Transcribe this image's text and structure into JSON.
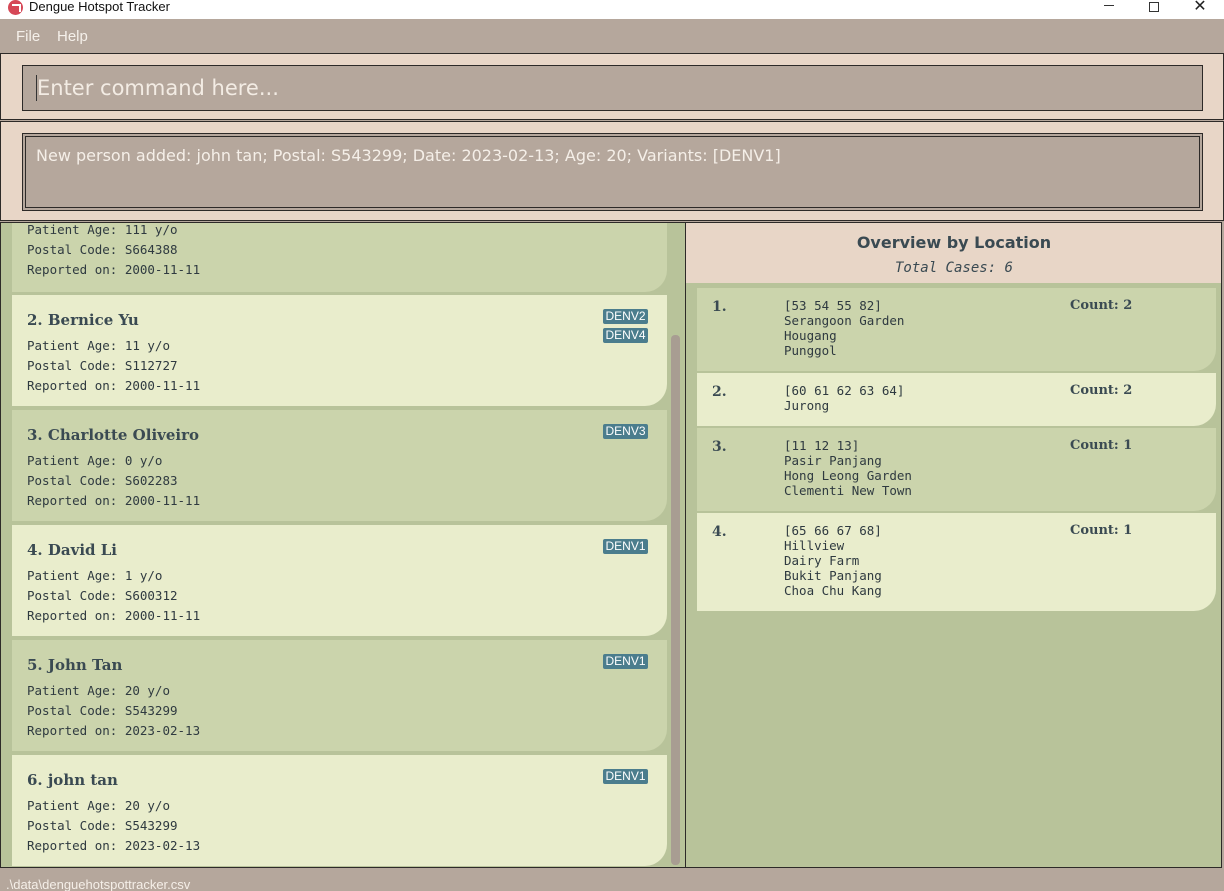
{
  "window": {
    "title": "Dengue Hotspot Tracker",
    "controls": {
      "minimize": "minimize-icon",
      "maximize": "maximize-icon",
      "close": "✕"
    }
  },
  "menu": {
    "file": "File",
    "help": "Help"
  },
  "command": {
    "placeholder": "Enter command here..."
  },
  "result": {
    "message": "New person added: john tan; Postal: S543299; Date: 2023-02-13; Age: 20; Variants: [DENV1]"
  },
  "persons": [
    {
      "name": "",
      "age": "Patient Age: 111 y/o",
      "postal": "Postal Code: S664388",
      "date": "Reported on: 2000-11-11",
      "variants": []
    },
    {
      "name": "2. Bernice Yu",
      "age": "Patient Age: 11 y/o",
      "postal": "Postal Code: S112727",
      "date": "Reported on: 2000-11-11",
      "variants": [
        "DENV2",
        "DENV4"
      ]
    },
    {
      "name": "3. Charlotte Oliveiro",
      "age": "Patient Age: 0 y/o",
      "postal": "Postal Code: S602283",
      "date": "Reported on: 2000-11-11",
      "variants": [
        "DENV3"
      ]
    },
    {
      "name": "4. David Li",
      "age": "Patient Age: 1 y/o",
      "postal": "Postal Code: S600312",
      "date": "Reported on: 2000-11-11",
      "variants": [
        "DENV1"
      ]
    },
    {
      "name": "5. John Tan",
      "age": "Patient Age: 20 y/o",
      "postal": "Postal Code: S543299",
      "date": "Reported on: 2023-02-13",
      "variants": [
        "DENV1"
      ]
    },
    {
      "name": "6. john tan",
      "age": "Patient Age: 20 y/o",
      "postal": "Postal Code: S543299",
      "date": "Reported on: 2023-02-13",
      "variants": [
        "DENV1"
      ]
    }
  ],
  "overview": {
    "title": "Overview by Location",
    "total": "Total Cases: 6",
    "locations": [
      {
        "index": "1.",
        "postals": "[53 54 55 82]",
        "areas": [
          "Serangoon Garden",
          "Hougang",
          "Punggol"
        ],
        "count": "Count: 2"
      },
      {
        "index": "2.",
        "postals": "[60 61 62 63 64]",
        "areas": [
          "Jurong"
        ],
        "count": "Count: 2"
      },
      {
        "index": "3.",
        "postals": "[11 12 13]",
        "areas": [
          "Pasir Panjang",
          "Hong Leong Garden",
          "Clementi New Town"
        ],
        "count": "Count: 1"
      },
      {
        "index": "4.",
        "postals": "[65 66 67 68]",
        "areas": [
          "Hillview",
          "Dairy Farm",
          "Bukit Panjang",
          "Choa Chu Kang"
        ],
        "count": "Count: 1"
      }
    ]
  },
  "status": {
    "path": ".\\data\\denguehotspottracker.csv"
  }
}
